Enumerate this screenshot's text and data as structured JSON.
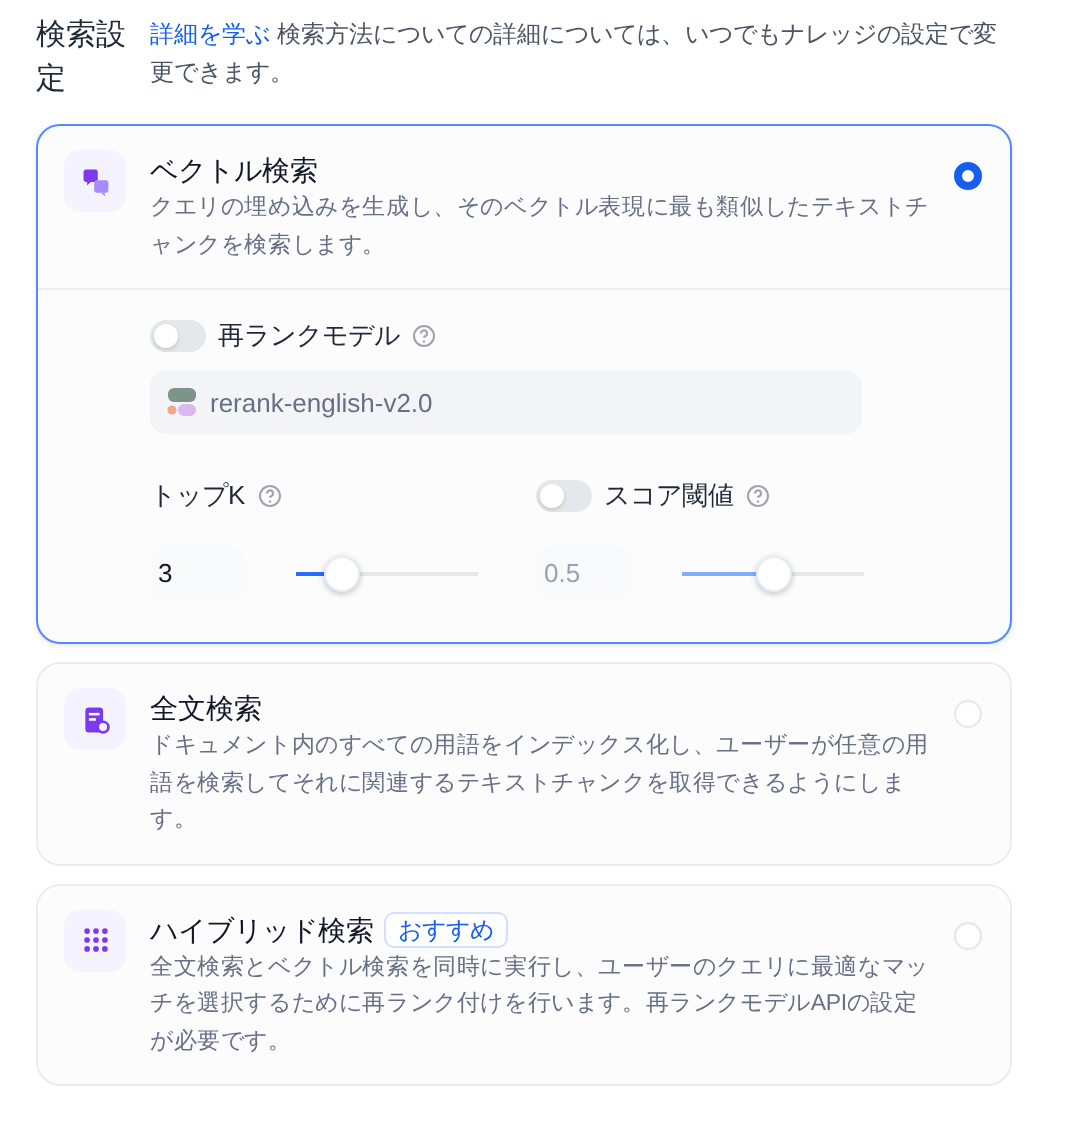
{
  "section": {
    "title": "検索設定",
    "link": "詳細を学ぶ",
    "description": "検索方法についての詳細については、いつでもナレッジの設定で変更できます。"
  },
  "options": [
    {
      "title": "ベクトル検索",
      "description": "クエリの埋め込みを生成し、そのベクトル表現に最も類似したテキストチャンクを検索します。",
      "selected": true,
      "settings": {
        "rerank": {
          "label": "再ランクモデル",
          "on": false,
          "model": "rerank-english-v2.0"
        },
        "top_k": {
          "label": "トップK",
          "value": "3",
          "level": 0.25
        },
        "score_threshold": {
          "label": "スコア閾値",
          "on": false,
          "value": "0.5",
          "level": 0.5
        }
      }
    },
    {
      "title": "全文検索",
      "description": "ドキュメント内のすべての用語をインデックス化し、ユーザーが任意の用語を検索してそれに関連するテキストチャンクを取得できるようにします。",
      "selected": false
    },
    {
      "title": "ハイブリッド検索",
      "badge": "おすすめ",
      "description": "全文検索とベクトル検索を同時に実行し、ユーザーのクエリに最適なマッチを選択するために再ランク付けを行います。再ランクモデルAPIの設定が必要です。",
      "selected": false
    }
  ]
}
